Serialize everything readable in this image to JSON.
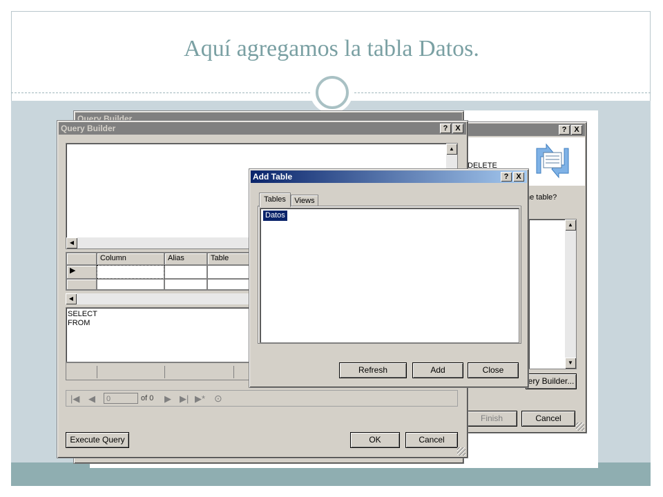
{
  "slide": {
    "title": "Aquí agregamos la tabla Datos."
  },
  "back_window": {
    "title": "Query Builder"
  },
  "wizard": {
    "delete_text": "DELETE",
    "question_text": "he table?",
    "query_builder_btn": "ery Builder...",
    "finish_btn": "Finish",
    "cancel_btn": "Cancel"
  },
  "query_builder": {
    "title": "Query Builder",
    "help_btn": "?",
    "close_btn": "X",
    "grid_headers": [
      "Column",
      "Alias",
      "Table"
    ],
    "sql_lines": [
      "SELECT",
      "FROM"
    ],
    "nav": {
      "record_value": "0",
      "of_label": "of 0"
    },
    "execute_btn": "Execute Query",
    "ok_btn": "OK",
    "cancel_btn": "Cancel"
  },
  "add_table": {
    "title": "Add Table",
    "help_btn": "?",
    "close_btn": "X",
    "tabs": [
      "Tables",
      "Views"
    ],
    "items": [
      "Datos"
    ],
    "refresh_btn": "Refresh",
    "add_btn": "Add",
    "close_label": "Close"
  },
  "colors": {
    "accent": "#7aa0a3",
    "band": "#c9d6dc",
    "bottom_band": "#8faeb1",
    "titlebar": "#0a246a",
    "selection": "#0a246a"
  }
}
